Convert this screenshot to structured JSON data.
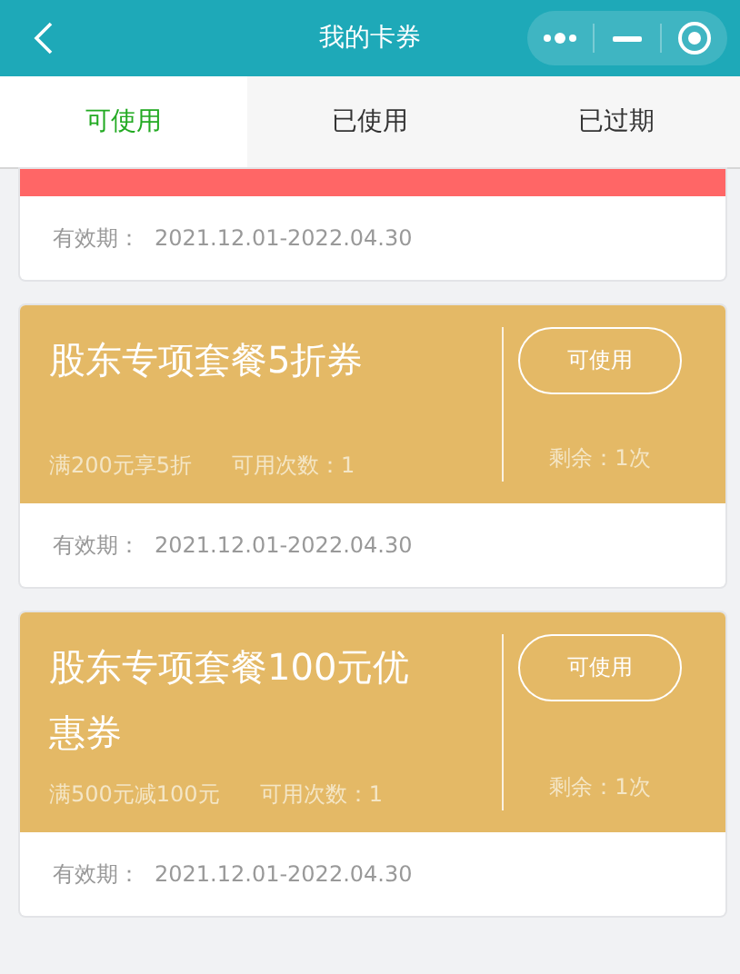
{
  "header": {
    "title": "我的卡券"
  },
  "tabs": [
    {
      "label": "可使用",
      "selected": true
    },
    {
      "label": "已使用",
      "selected": false
    },
    {
      "label": "已过期",
      "selected": false
    }
  ],
  "coupons": [
    {
      "kind": "clipped",
      "color": "#ff6666",
      "validity_label": "有效期：",
      "validity": "2021.12.01-2022.04.30"
    },
    {
      "kind": "full",
      "color": "#e4b966",
      "title": "股东专项套餐5折券",
      "condition": "满200元享5折",
      "uses": "可用次数：1",
      "button": "可使用",
      "remaining": "剩余：1次",
      "validity_label": "有效期：",
      "validity": "2021.12.01-2022.04.30"
    },
    {
      "kind": "full",
      "color": "#e4b966",
      "title": "股东专项套餐100元优惠券",
      "condition": "满500元减100元",
      "uses": "可用次数：1",
      "button": "可使用",
      "remaining": "剩余：1次",
      "validity_label": "有效期：",
      "validity": "2021.12.01-2022.04.30"
    }
  ]
}
